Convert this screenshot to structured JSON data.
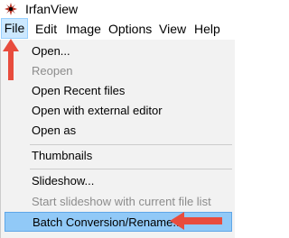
{
  "titlebar": {
    "title": "IrfanView",
    "icon": "irfanview-logo-icon"
  },
  "menubar": {
    "items": [
      "File",
      "Edit",
      "Image",
      "Options",
      "View",
      "Help"
    ]
  },
  "dropdown": {
    "items": [
      {
        "label": "Open...",
        "enabled": true
      },
      {
        "label": "Reopen",
        "enabled": false
      },
      {
        "label": "Open Recent files",
        "enabled": true
      },
      {
        "label": "Open with external editor",
        "enabled": true
      },
      {
        "label": "Open as",
        "enabled": true
      },
      {
        "label": "Thumbnails",
        "enabled": true
      },
      {
        "label": "Slideshow...",
        "enabled": true
      },
      {
        "label": "Start slideshow with current file list",
        "enabled": false
      },
      {
        "label": "Batch Conversion/Rename...",
        "enabled": true,
        "highlighted": true
      }
    ]
  },
  "annotations": {
    "arrow_color": "#e84c3d",
    "arrows": [
      "up-arrow-icon",
      "left-arrow-icon"
    ]
  },
  "colors": {
    "highlight": "#91c9f7",
    "menu_bg": "#f2f2f2",
    "file_active": "#cce8ff"
  }
}
